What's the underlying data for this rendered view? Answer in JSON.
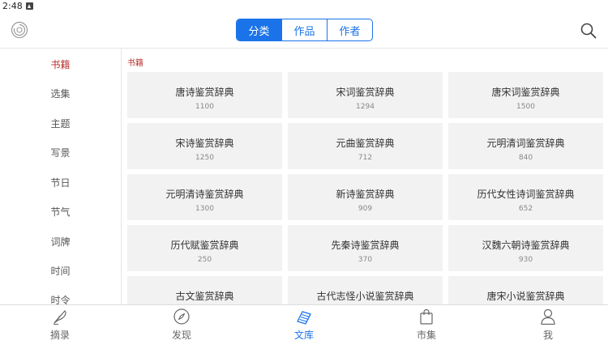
{
  "status": {
    "time": "2:48"
  },
  "header": {
    "tabs": [
      {
        "label": "分类",
        "active": true
      },
      {
        "label": "作品",
        "active": false
      },
      {
        "label": "作者",
        "active": false
      }
    ]
  },
  "sidebar": {
    "items": [
      {
        "label": "书籍",
        "active": true
      },
      {
        "label": "选集",
        "active": false
      },
      {
        "label": "主题",
        "active": false
      },
      {
        "label": "写景",
        "active": false
      },
      {
        "label": "节日",
        "active": false
      },
      {
        "label": "节气",
        "active": false
      },
      {
        "label": "词牌",
        "active": false
      },
      {
        "label": "时间",
        "active": false
      },
      {
        "label": "时令",
        "active": false
      }
    ]
  },
  "content": {
    "section_title": "书籍",
    "books": [
      {
        "title": "唐诗鉴赏辞典",
        "count": "1100"
      },
      {
        "title": "宋词鉴赏辞典",
        "count": "1294"
      },
      {
        "title": "唐宋词鉴赏辞典",
        "count": "1500"
      },
      {
        "title": "宋诗鉴赏辞典",
        "count": "1250"
      },
      {
        "title": "元曲鉴赏辞典",
        "count": "712"
      },
      {
        "title": "元明清词鉴赏辞典",
        "count": "840"
      },
      {
        "title": "元明清诗鉴赏辞典",
        "count": "1300"
      },
      {
        "title": "新诗鉴赏辞典",
        "count": "909"
      },
      {
        "title": "历代女性诗词鉴赏辞典",
        "count": "652"
      },
      {
        "title": "历代赋鉴赏辞典",
        "count": "250"
      },
      {
        "title": "先秦诗鉴赏辞典",
        "count": "370"
      },
      {
        "title": "汉魏六朝诗鉴赏辞典",
        "count": "930"
      },
      {
        "title": "古文鉴赏辞典",
        "count": ""
      },
      {
        "title": "古代志怪小说鉴赏辞典",
        "count": ""
      },
      {
        "title": "唐宋小说鉴赏辞典",
        "count": ""
      }
    ]
  },
  "bottom_nav": {
    "items": [
      {
        "label": "摘录",
        "icon": "quill-pen-icon",
        "active": false
      },
      {
        "label": "发现",
        "icon": "compass-icon",
        "active": false
      },
      {
        "label": "文库",
        "icon": "books-icon",
        "active": true
      },
      {
        "label": "市集",
        "icon": "shopping-bag-icon",
        "active": false
      },
      {
        "label": "我",
        "icon": "person-icon",
        "active": false
      }
    ]
  },
  "colors": {
    "accent": "#1a73e8",
    "sidebar_active": "#b5302c",
    "card_bg": "#f2f2f2"
  }
}
